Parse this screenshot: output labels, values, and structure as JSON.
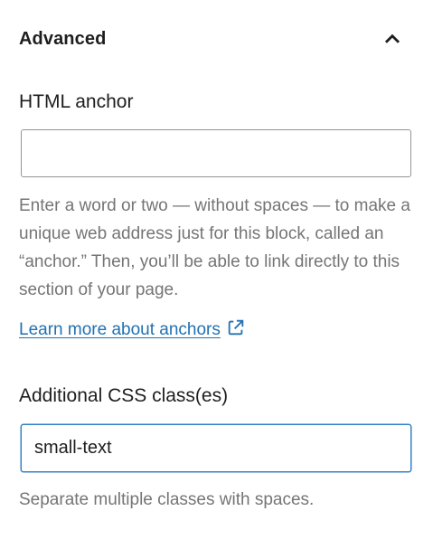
{
  "panel": {
    "title": "Advanced",
    "expanded": true,
    "toggle_icon": "chevron-up-icon"
  },
  "anchor": {
    "label": "HTML anchor",
    "value": "",
    "placeholder": "",
    "help": "Enter a word or two — without spaces — to make a unique web address just for this block, called an “anchor.” Then, you’ll be able to link directly to this section of your page.",
    "link_label": "Learn more about anchors",
    "link_icon": "external-link-icon"
  },
  "css_class": {
    "label": "Additional CSS class(es)",
    "value": "small-text",
    "help": "Separate multiple classes with spaces."
  },
  "colors": {
    "text": "#1e1e1e",
    "help_text": "#757575",
    "link": "#2271b1",
    "input_border": "#949494",
    "focus_border": "#3582c4"
  }
}
